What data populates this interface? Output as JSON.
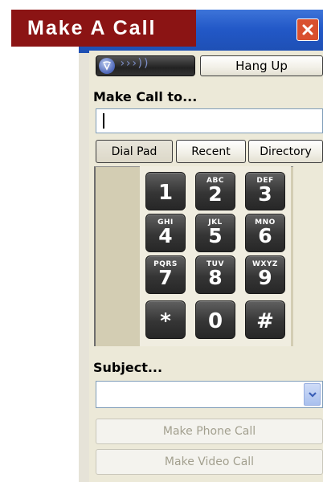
{
  "window": {
    "title": "Make A Call",
    "close_glyph": "✕"
  },
  "status": {
    "signal_icon": "phone-signal-icon",
    "signal_waves": "›››))",
    "hang_up_label": "Hang Up"
  },
  "call_to": {
    "label": "Make Call to...",
    "value": ""
  },
  "tabs": [
    {
      "label": "Dial Pad",
      "active": true
    },
    {
      "label": "Recent",
      "active": false
    },
    {
      "label": "Directory",
      "active": false
    }
  ],
  "dialpad": {
    "keys": [
      {
        "digit": "1",
        "letters": ""
      },
      {
        "digit": "2",
        "letters": "ABC"
      },
      {
        "digit": "3",
        "letters": "DEF"
      },
      {
        "digit": "4",
        "letters": "GHI"
      },
      {
        "digit": "5",
        "letters": "JKL"
      },
      {
        "digit": "6",
        "letters": "MNO"
      },
      {
        "digit": "7",
        "letters": "PQRS"
      },
      {
        "digit": "8",
        "letters": "TUV"
      },
      {
        "digit": "9",
        "letters": "WXYZ"
      },
      {
        "digit": "*",
        "letters": ""
      },
      {
        "digit": "0",
        "letters": ""
      },
      {
        "digit": "#",
        "letters": ""
      }
    ]
  },
  "subject": {
    "label": "Subject...",
    "value": ""
  },
  "actions": {
    "phone_call_label": "Make Phone Call",
    "video_call_label": "Make Video Call"
  },
  "colors": {
    "title_banner": "#8b1414",
    "titlebar": "#2258c7",
    "close_button": "#d9502f",
    "key_face": "#353535",
    "disabled_text": "#a3a08f"
  }
}
